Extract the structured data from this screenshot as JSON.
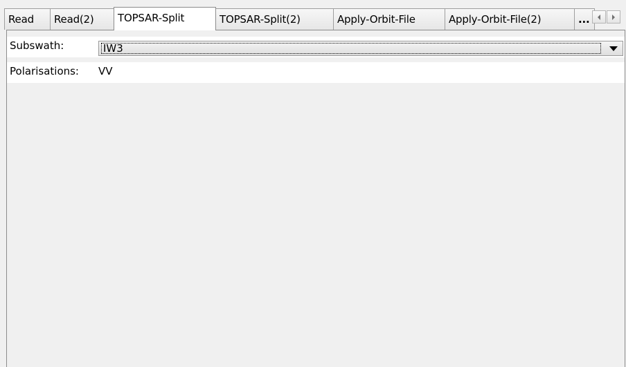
{
  "tabs": [
    {
      "label": "Read"
    },
    {
      "label": "Read(2)"
    },
    {
      "label": "TOPSAR-Split",
      "active": true
    },
    {
      "label": "TOPSAR-Split(2)"
    },
    {
      "label": "Apply-Orbit-File"
    },
    {
      "label": "Apply-Orbit-File(2)"
    },
    {
      "label": "..."
    }
  ],
  "form": {
    "subswath_label": "Subswath:",
    "subswath_value": "IW3",
    "polarisations_label": "Polarisations:",
    "polarisations_value": "VV"
  },
  "icons": {
    "tab_scroll_left": "chevron-left-icon",
    "tab_scroll_right": "chevron-right-icon",
    "combo_arrow": "chevron-down-icon"
  }
}
